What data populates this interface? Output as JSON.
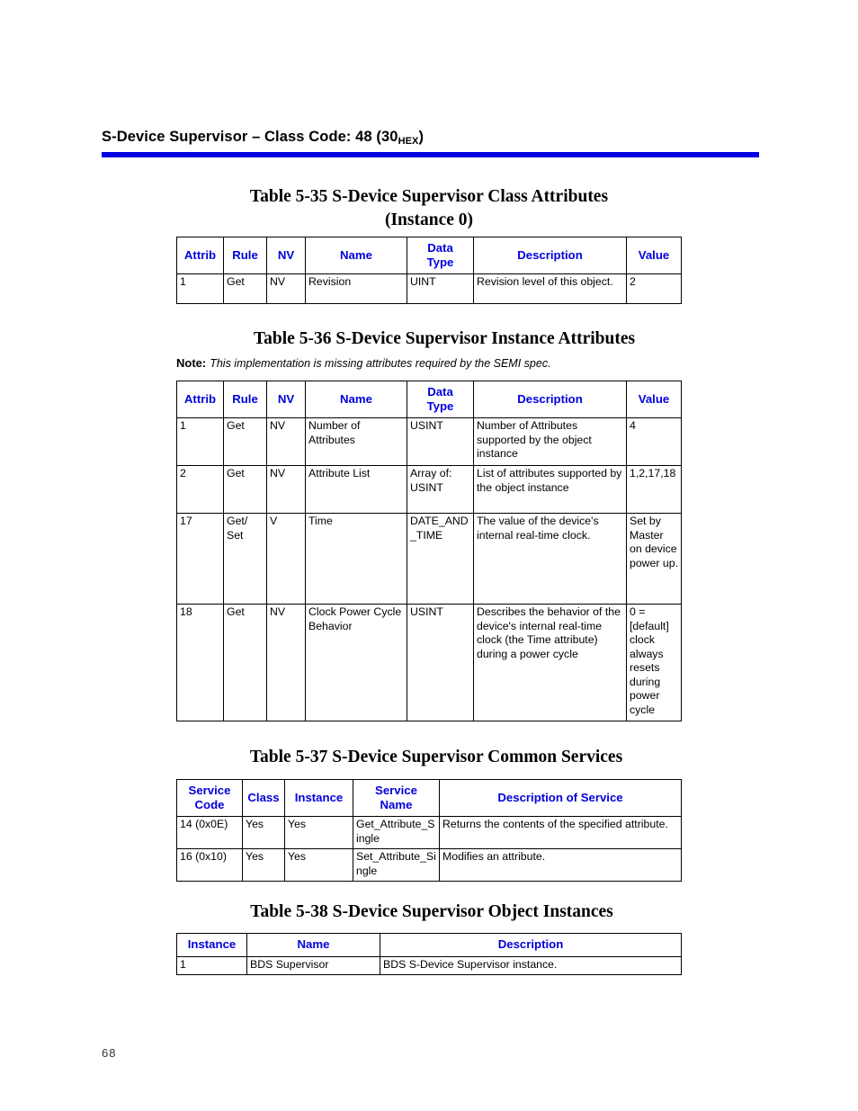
{
  "page": {
    "folio": "68",
    "accent_color": "#0000e0",
    "header_text_color": "#0000dd"
  },
  "running_head": {
    "text_before": "S-Device Supervisor – Class Code: 48 (30",
    "subscript": "HEX",
    "text_after": ")"
  },
  "table_5_35": {
    "caption_line1": "Table 5-35   S-Device Supervisor Class Attributes",
    "caption_line2": "(Instance 0)",
    "columns": [
      "Attrib",
      "Rule",
      "NV",
      "Name",
      "Data\nType",
      "Description",
      "Value"
    ],
    "rows": [
      {
        "attrib": "1",
        "rule": "Get",
        "nv": "NV",
        "name": "Revision",
        "data_type": "UINT",
        "description": "Revision level of this object.",
        "value": "2"
      }
    ]
  },
  "table_5_36": {
    "caption_line1": "Table 5-36   S-Device Supervisor Instance Attributes",
    "note_label": "Note:",
    "note_body": "This implementation is missing attributes required by the SEMI spec.",
    "columns": [
      "Attrib",
      "Rule",
      "NV",
      "Name",
      "Data\nType",
      "Description",
      "Value"
    ],
    "rows": [
      {
        "attrib": "1",
        "rule": "Get",
        "nv": "NV",
        "name": "Number of Attributes",
        "data_type": "USINT",
        "description": "Number of Attributes supported by the object instance",
        "value": "4"
      },
      {
        "attrib": "2",
        "rule": "Get",
        "nv": "NV",
        "name": "Attribute List",
        "data_type": "Array of: USINT",
        "description": "List of attributes supported by the object instance",
        "value": "1,2,17,18"
      },
      {
        "attrib": "17",
        "rule": "Get/ Set",
        "nv": "V",
        "name": "Time",
        "data_type": "DATE_AND_TIME",
        "description": "The value of the device's internal real-time clock.",
        "value": "Set by Master on device power up."
      },
      {
        "attrib": "18",
        "rule": "Get",
        "nv": "NV",
        "name": "Clock Power Cycle Behavior",
        "data_type": "USINT",
        "description": "Describes the behavior of the device's internal real-time clock (the Time attribute) during a power cycle",
        "value": "0 = [default] clock always resets during power cycle"
      }
    ]
  },
  "table_5_37": {
    "caption_line1": "Table 5-37   S-Device Supervisor Common Services",
    "columns": [
      "Service\nCode",
      "Class",
      "Instance",
      "Service\nName",
      "Description of Service"
    ],
    "rows": [
      {
        "service_code": "14 (0x0E)",
        "class": "Yes",
        "instance": "Yes",
        "service_name": "Get_Attribute_Single",
        "description": "Returns the contents of the specified attribute."
      },
      {
        "service_code": "16 (0x10)",
        "class": "Yes",
        "instance": "Yes",
        "service_name": "Set_Attribute_Single",
        "description": "Modifies an attribute."
      }
    ]
  },
  "table_5_38": {
    "caption_line1": "Table 5-38   S-Device Supervisor Object Instances",
    "columns": [
      "Instance",
      "Name",
      "Description"
    ],
    "rows": [
      {
        "instance": "1",
        "name": "BDS Supervisor",
        "description": "BDS S-Device Supervisor instance."
      }
    ]
  }
}
